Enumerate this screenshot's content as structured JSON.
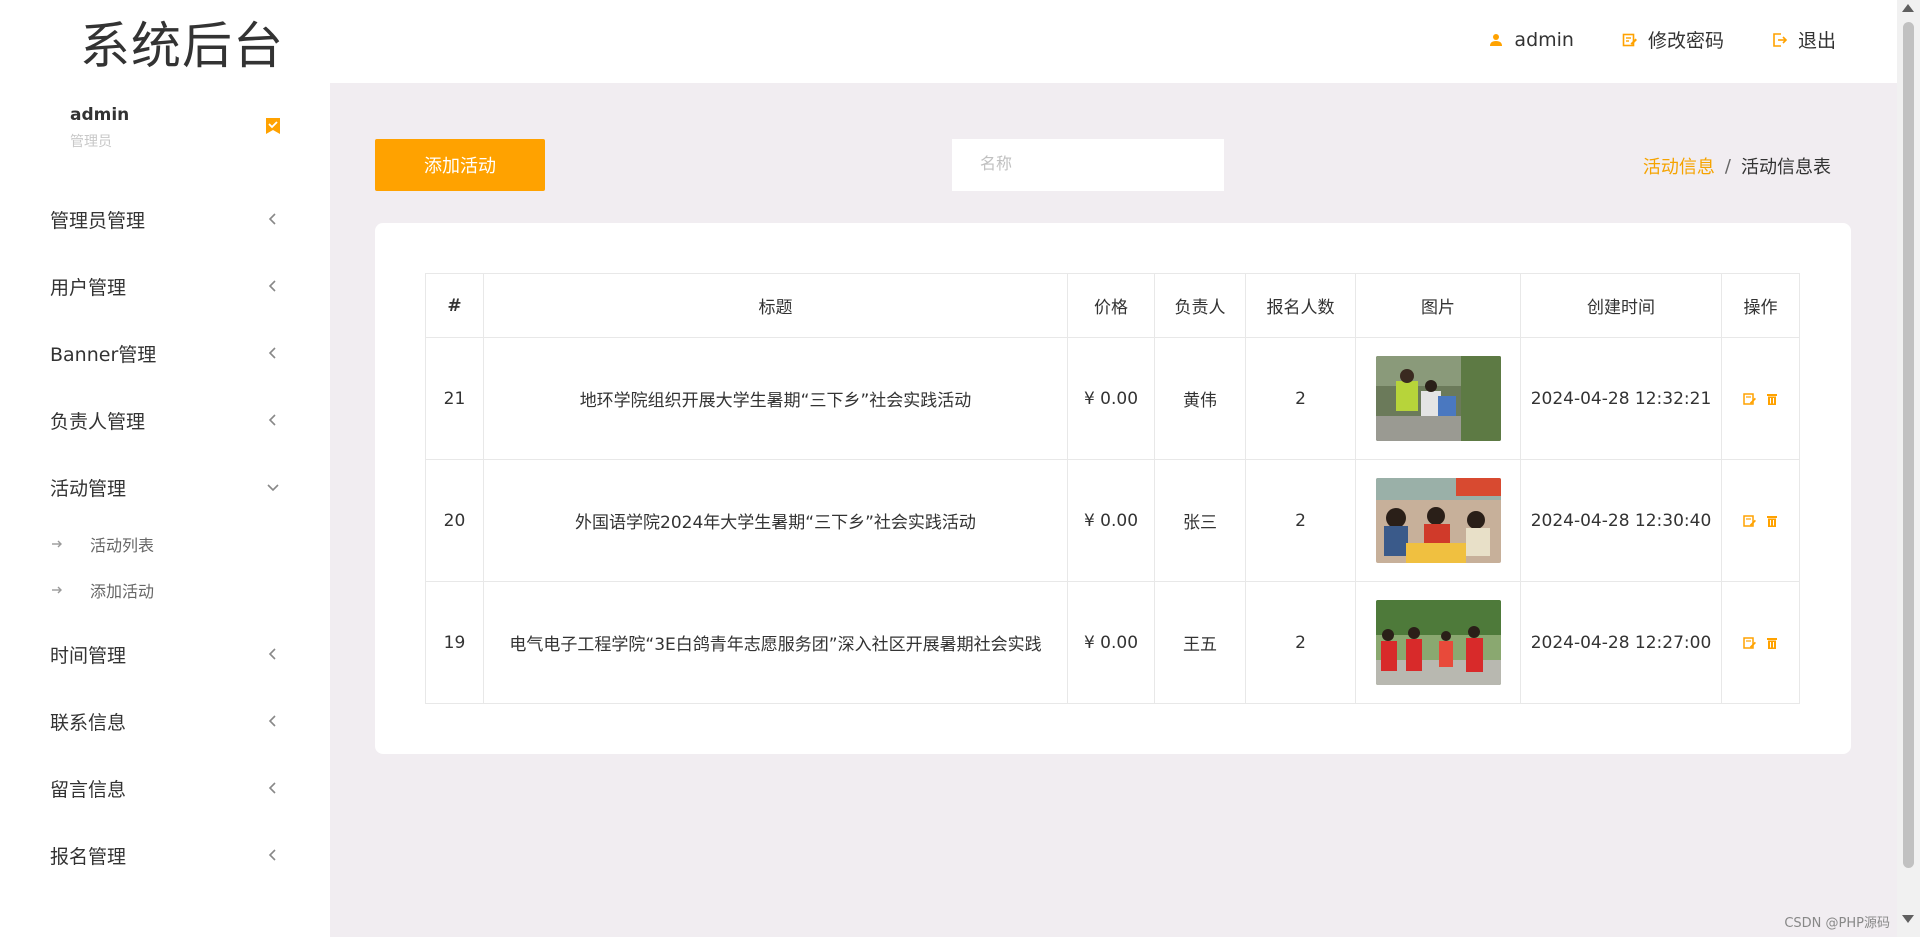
{
  "header": {
    "logo": "系统后台",
    "nav": [
      {
        "label": "admin",
        "icon": "user-icon"
      },
      {
        "label": "修改密码",
        "icon": "edit-icon"
      },
      {
        "label": "退出",
        "icon": "logout-icon"
      }
    ]
  },
  "sidebar": {
    "user_name": "admin",
    "user_role": "管理员",
    "items": [
      {
        "label": "管理员管理"
      },
      {
        "label": "用户管理"
      },
      {
        "label": "Banner管理"
      },
      {
        "label": "负责人管理"
      },
      {
        "label": "活动管理"
      },
      {
        "label": "时间管理"
      },
      {
        "label": "联系信息"
      },
      {
        "label": "留言信息"
      },
      {
        "label": "报名管理"
      }
    ],
    "activity_sub": [
      {
        "label": "活动列表"
      },
      {
        "label": "添加活动"
      }
    ]
  },
  "main": {
    "add_button": "添加活动",
    "search_placeholder": "名称",
    "breadcrumb": {
      "link": "活动信息",
      "separator": "/",
      "current": "活动信息表"
    },
    "table": {
      "headers": [
        "#",
        "标题",
        "价格",
        "负责人",
        "报名人数",
        "图片",
        "创建时间",
        "操作"
      ],
      "rows": [
        {
          "id": "21",
          "title": "地环学院组织开展大学生暑期“三下乡”社会实践活动",
          "price": "¥ 0.00",
          "owner": "黄伟",
          "count": "2",
          "created": "2024-04-28 12:32:21"
        },
        {
          "id": "20",
          "title": "外国语学院2024年大学生暑期“三下乡”社会实践活动",
          "price": "¥ 0.00",
          "owner": "张三",
          "count": "2",
          "created": "2024-04-28 12:30:40"
        },
        {
          "id": "19",
          "title": "电气电子工程学院“3E白鸽青年志愿服务团”深入社区开展暑期社会实践",
          "price": "¥ 0.00",
          "owner": "王五",
          "count": "2",
          "created": "2024-04-28 12:27:00"
        }
      ]
    }
  },
  "watermark": "CSDN @PHP源码",
  "colors": {
    "accent": "#ffa200",
    "main_bg": "#f1edf1"
  }
}
